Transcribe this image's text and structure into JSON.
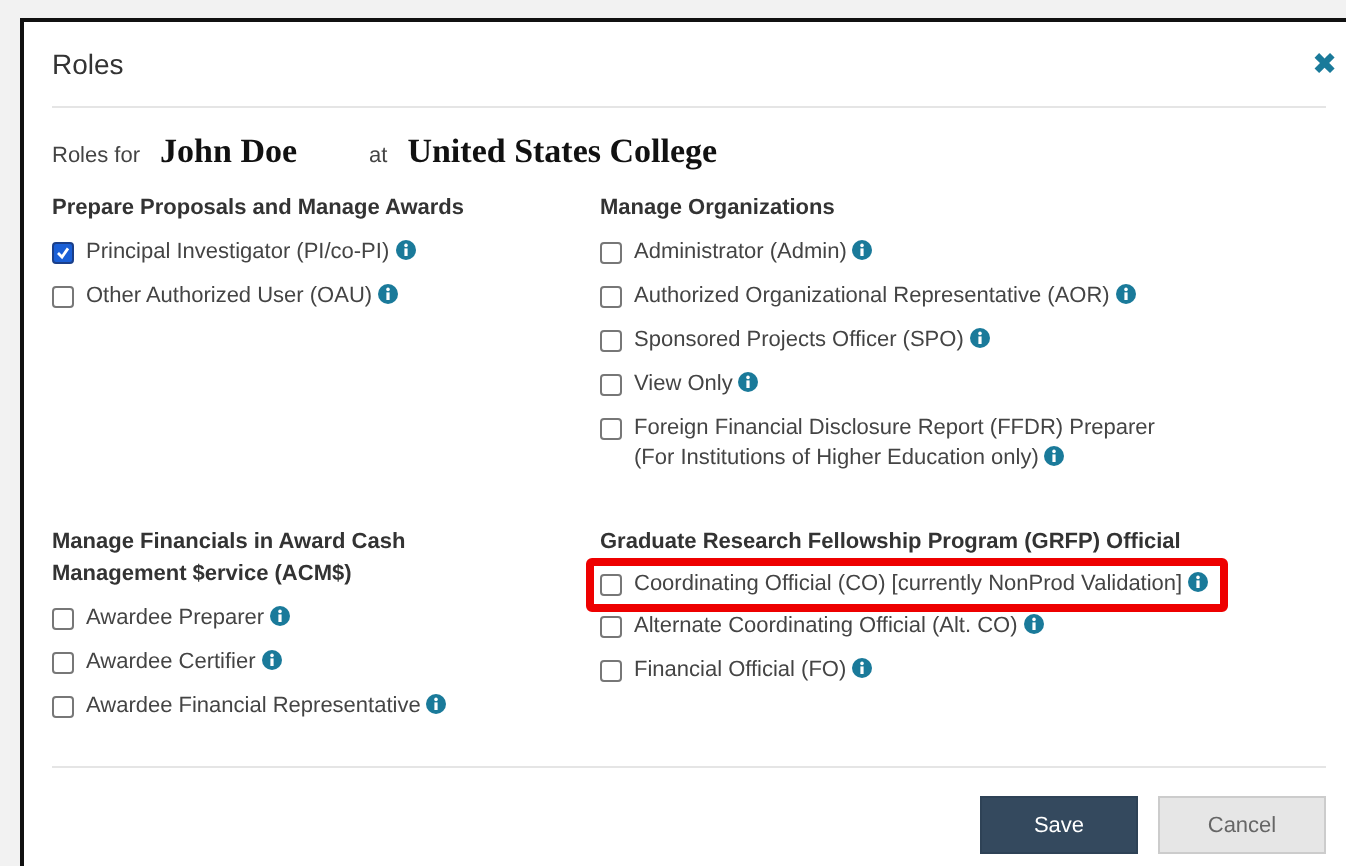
{
  "dialog": {
    "title": "Roles",
    "close": "✖"
  },
  "intro": {
    "prefix": "Roles for",
    "name": "John Doe",
    "connector": "at",
    "institution": "United States College"
  },
  "groups": [
    {
      "title": "Prepare Proposals and Manage Awards",
      "roles": [
        {
          "label": "Principal Investigator (PI/co-PI)",
          "checked": true,
          "highlighted": false
        },
        {
          "label": "Other Authorized User (OAU)",
          "checked": false,
          "highlighted": false
        }
      ]
    },
    {
      "title": "Manage Organizations",
      "roles": [
        {
          "label": "Administrator (Admin)",
          "checked": false,
          "highlighted": false
        },
        {
          "label": "Authorized Organizational Representative (AOR)",
          "checked": false,
          "highlighted": false
        },
        {
          "label": "Sponsored Projects Officer (SPO)",
          "checked": false,
          "highlighted": false
        },
        {
          "label": "View Only",
          "checked": false,
          "highlighted": false
        },
        {
          "label": "Foreign Financial Disclosure Report (FFDR) Preparer\n(For Institutions of Higher Education only)",
          "checked": false,
          "highlighted": false
        }
      ]
    },
    {
      "title": "Manage Financials in Award Cash\nManagement $ervice (ACM$)",
      "roles": [
        {
          "label": "Awardee Preparer",
          "checked": false,
          "highlighted": false
        },
        {
          "label": "Awardee Certifier",
          "checked": false,
          "highlighted": false
        },
        {
          "label": "Awardee Financial Representative",
          "checked": false,
          "highlighted": false
        }
      ]
    },
    {
      "title": "Graduate Research Fellowship Program (GRFP) Official",
      "roles": [
        {
          "label": "Coordinating Official (CO) [currently NonProd Validation]",
          "checked": false,
          "highlighted": true
        },
        {
          "label": "Alternate Coordinating Official (Alt. CO)",
          "checked": false,
          "highlighted": false
        },
        {
          "label": "Financial Official (FO)",
          "checked": false,
          "highlighted": false
        }
      ]
    }
  ],
  "buttons": [
    {
      "label": "Save",
      "kind": "primary"
    },
    {
      "label": "Cancel",
      "kind": "secondary"
    }
  ]
}
